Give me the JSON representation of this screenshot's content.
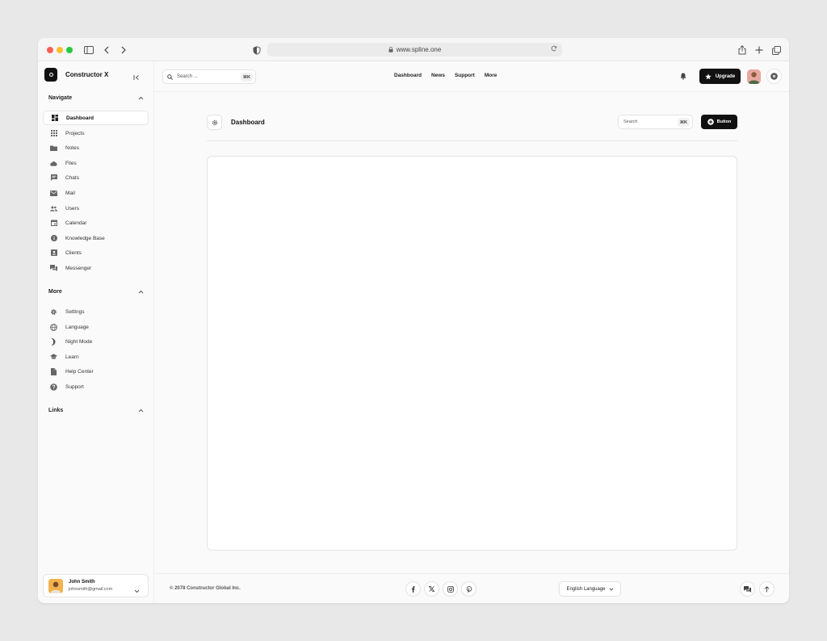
{
  "browser": {
    "url": "www.spline.one"
  },
  "brand": {
    "name": "Constructor X"
  },
  "sidebar": {
    "navigate_title": "Navigate",
    "navigate_items": [
      {
        "label": "Dashboard",
        "icon": "dashboard-icon",
        "active": true
      },
      {
        "label": "Projects",
        "icon": "grid-icon"
      },
      {
        "label": "Notes",
        "icon": "folder-icon"
      },
      {
        "label": "Files",
        "icon": "cloud-icon"
      },
      {
        "label": "Chats",
        "icon": "chat-icon"
      },
      {
        "label": "Mail",
        "icon": "mail-icon"
      },
      {
        "label": "Users",
        "icon": "users-icon"
      },
      {
        "label": "Calendar",
        "icon": "calendar-icon"
      },
      {
        "label": "Knowledge Base",
        "icon": "info-icon"
      },
      {
        "label": "Clients",
        "icon": "contact-icon"
      },
      {
        "label": "Messenger",
        "icon": "messenger-icon"
      }
    ],
    "more_title": "More",
    "more_items": [
      {
        "label": "Settings",
        "icon": "gear-icon"
      },
      {
        "label": "Language",
        "icon": "globe-icon"
      },
      {
        "label": "Night Mode",
        "icon": "moon-icon"
      },
      {
        "label": "Learn",
        "icon": "graduation-cap-icon"
      },
      {
        "label": "Help Center",
        "icon": "document-icon"
      },
      {
        "label": "Support",
        "icon": "help-icon"
      }
    ],
    "links_title": "Links"
  },
  "user": {
    "name": "John Smith",
    "email": "johnsmith@gmail.com"
  },
  "topbar": {
    "search_placeholder": "Search ...",
    "search_shortcut": "⌘K",
    "nav": [
      "Dashboard",
      "News",
      "Support",
      "More"
    ],
    "upgrade_label": "Upgrade"
  },
  "content": {
    "title": "Dashboard",
    "search_placeholder": "Search",
    "search_shortcut": "⌘K",
    "button_label": "Button"
  },
  "footer": {
    "copyright": "© 2078 Constructor Global Inc.",
    "social": [
      "facebook-icon",
      "x-icon",
      "instagram-icon",
      "pinterest-icon"
    ],
    "language": "English Language"
  },
  "colors": {
    "accent": "#111111",
    "background": "#fafafa",
    "page": "#e8e8e8"
  }
}
